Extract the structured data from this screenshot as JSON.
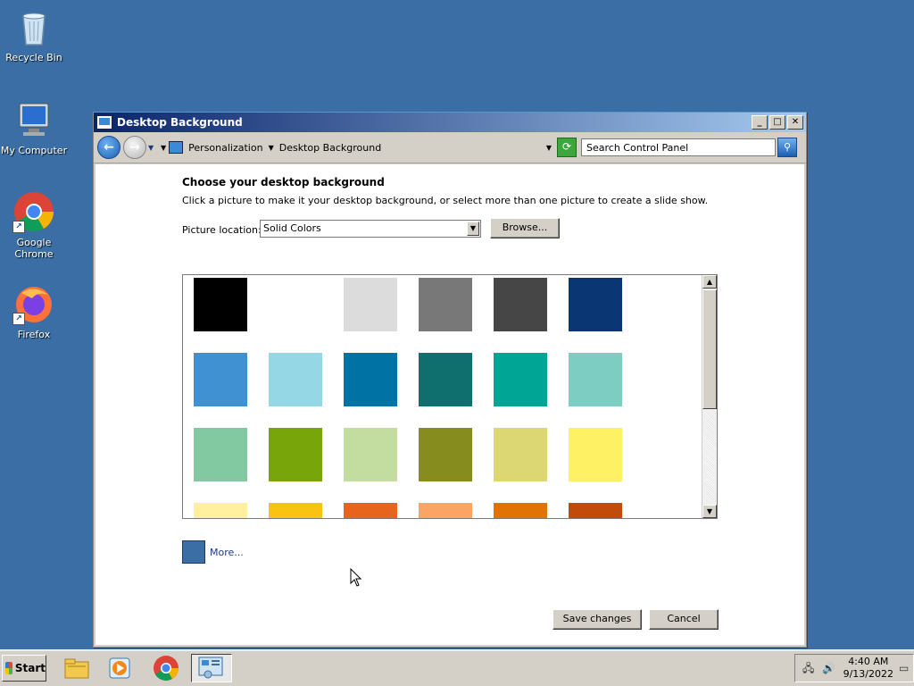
{
  "desktop": {
    "icons": [
      {
        "label": "Recycle Bin"
      },
      {
        "label": "My Computer"
      },
      {
        "label": "Google Chrome"
      },
      {
        "label": "Firefox"
      }
    ]
  },
  "window": {
    "title": "Desktop Background",
    "breadcrumb": [
      "Personalization",
      "Desktop Background"
    ],
    "search_placeholder": "Search Control Panel",
    "heading": "Choose your desktop background",
    "description": "Click a picture to make it your desktop background, or select more than one picture to create a slide show.",
    "picture_location_label": "Picture location:",
    "picture_location_value": "Solid Colors",
    "browse_label": "Browse...",
    "swatches": [
      {
        "color": "#000000"
      },
      {
        "color": "#ffffff"
      },
      {
        "color": "#dcdcdc"
      },
      {
        "color": "#787878"
      },
      {
        "color": "#464646"
      },
      {
        "color": "#0a3773"
      },
      {
        "color": "#4091d2"
      },
      {
        "color": "#96d7e6"
      },
      {
        "color": "#0073a5"
      },
      {
        "color": "#0f6e6e"
      },
      {
        "color": "#00a596"
      },
      {
        "color": "#7dcdc3"
      },
      {
        "color": "#82c8a0"
      },
      {
        "color": "#78a50a"
      },
      {
        "color": "#c3dca0"
      },
      {
        "color": "#878c1e"
      },
      {
        "color": "#dcd773"
      },
      {
        "color": "#fff064"
      },
      {
        "color": "#fff0a0"
      },
      {
        "color": "#fac314"
      },
      {
        "color": "#e6641e"
      },
      {
        "color": "#faa564"
      },
      {
        "color": "#e17305"
      },
      {
        "color": "#c34b0a"
      }
    ],
    "more_color": "#3a6ea5",
    "more_label": "More...",
    "save_label": "Save changes",
    "cancel_label": "Cancel"
  },
  "taskbar": {
    "start_label": "Start",
    "time": "4:40 AM",
    "date": "9/13/2022"
  }
}
